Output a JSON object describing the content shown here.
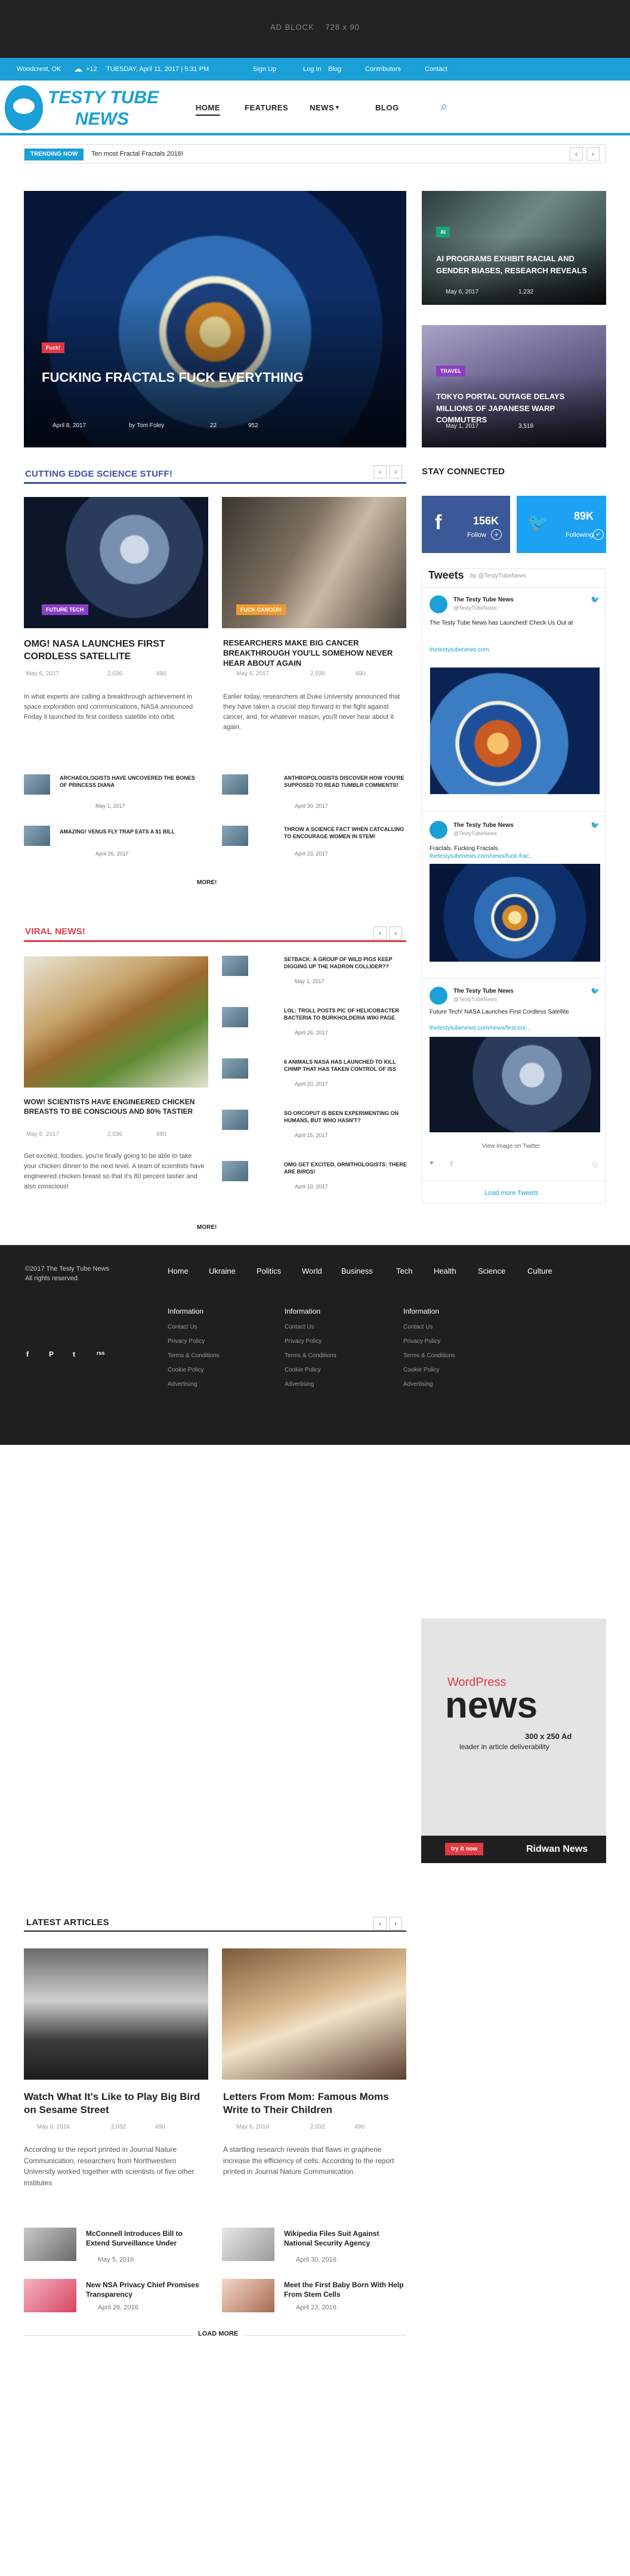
{
  "ad_top": {
    "label": "AD BLOCK",
    "size": "728 x 90"
  },
  "topbar": {
    "location": "Woodcrest, OK",
    "weather_temp": "+12",
    "date": "TUESDAY, April 11, 2017 | 5:31 PM",
    "links": [
      "Sign Up",
      "Log In",
      "Blog",
      "Contributors",
      "Contact"
    ]
  },
  "logo": {
    "line1": "TESTY TUBE",
    "line2": "NEWS"
  },
  "nav": {
    "items": [
      "HOME",
      "FEATURES",
      "NEWS",
      "BLOG"
    ],
    "news_caret": "▾"
  },
  "ticker": {
    "tag": "TRENDING NOW",
    "text": "Ten most Fractal Fractals 2016!"
  },
  "hero": {
    "main": {
      "category": "Fuck!",
      "title": "FUCKING FRACTALS FUCK EVERYTHING",
      "date": "April 8, 2017",
      "author": "by Tom Foley",
      "comments": "22",
      "views": "952"
    },
    "side1": {
      "category": "AI",
      "title": "AI PROGRAMS EXHIBIT RACIAL AND GENDER BIASES, RESEARCH REVEALS",
      "date": "May 6, 2017",
      "views": "1,232"
    },
    "side2": {
      "category": "TRAVEL",
      "title": "TOKYO PORTAL OUTAGE DELAYS MILLIONS OF JAPANESE WARP COMMUTERS",
      "date": "May 1, 2017",
      "views": "3,518"
    }
  },
  "science": {
    "heading": "CUTTING EDGE SCIENCE STUFF!",
    "color": "#3b4fa8",
    "post1": {
      "category": "FUTURE TECH",
      "title": "OMG! NASA LAUNCHES FIRST CORDLESS SATELLITE",
      "date": "May 6, 2017",
      "views": "2,036",
      "comments": "690",
      "excerpt": "In what experts are calling a breakthrough achievement in space exploration and communications, NASA announced Friday it launched its first cordless satellite into orbit."
    },
    "post2": {
      "category": "FUCK CANCER!",
      "title": "RESEARCHERS MAKE BIG CANCER BREAKTHROUGH YOU'LL SOMEHOW NEVER HEAR ABOUT AGAIN",
      "date": "May 6, 2017",
      "views": "2,036",
      "comments": "690",
      "excerpt": "Earlier today, researchers at Duke University announced that they have taken a crucial step forward in the fight against cancer, and, for whatever reason, you'll never hear about it again."
    },
    "list": [
      {
        "title": "ARCHAEOLOGISTS HAVE UNCOVERED THE BONES OF PRINCESS DIANA",
        "date": "May 1, 2017"
      },
      {
        "title": "ANTHROPOLOGISTS DISCOVER HOW YOU'RE SUPPOSED TO READ TUMBLR COMMENTS!",
        "date": "April 30, 2017"
      },
      {
        "title": "AMAZING! VENUS FLY TRAP EATS A $1 BILL",
        "date": "April 26, 2017"
      },
      {
        "title": "THROW A SCIENCE FACT WHEN CATCALLING TO ENCOURAGE WOMEN IN STEM!",
        "date": "April 23, 2017"
      }
    ],
    "more": "MORE!"
  },
  "viral": {
    "heading": "VIRAL NEWS!",
    "color": "#e03a45",
    "main": {
      "title": "WOW! SCIENTISTS HAVE ENGINEERED CHICKEN BREASTS TO BE CONSCIOUS AND 80% TASTIER",
      "date": "May 6, 2017",
      "views": "2,036",
      "comments": "690",
      "excerpt": "Get excited, foodies, you're finally going to be able to take your chicken dinner to the next level. A team of scientists have engineered chicken breast so that it's 80 percent tastier and also conscious!"
    },
    "list": [
      {
        "title": "SETBACK: A GROUP OF WILD PIGS KEEP DIGGING UP THE HADRON COLLIDER??",
        "date": "May 1, 2017"
      },
      {
        "title": "LOL: TROLL POSTS PIC OF HELICOBACTER BACTERIA TO BURKHOLDERIA WIKI PAGE",
        "date": "April 26, 2017"
      },
      {
        "title": "6 ANIMALS NASA HAS LAUNCHED TO KILL CHIMP THAT HAS TAKEN CONTROL OF ISS",
        "date": "April 20, 2017"
      },
      {
        "title": "SO ORCOPUT IS BEEN EXPERIMENTING ON HUMANS, BUT WHO HASN'T?",
        "date": "April 15, 2017"
      },
      {
        "title": "OMG GET EXCITED, ORNITHOLOGISTS: THERE ARE BIRDS!",
        "date": "April 10, 2017"
      }
    ],
    "more": "MORE!"
  },
  "sidebar": {
    "heading": "STAY CONNECTED",
    "facebook": {
      "count": "156K",
      "label": "Follow",
      "color": "#3b5998"
    },
    "twitter": {
      "count": "89K",
      "label": "Following",
      "color": "#1da1f2"
    },
    "tweets": {
      "title": "Tweets",
      "by": "by @TestyTubeNews",
      "items": [
        {
          "name": "The Testy Tube News",
          "handle": "@TestyTubeNews",
          "text": "The Testy Tube News has Launched! Check Us Out at",
          "link": "thetestytubenews.com"
        },
        {
          "name": "The Testy Tube News",
          "handle": "@TestyTubeNews",
          "text": "Fractals. Fucking Fractals.",
          "link": "thetestytubenews.com/news/fuck-frac..."
        },
        {
          "name": "The Testy Tube News",
          "handle": "@TestyTubeNews",
          "text": "Future Tech! NASA Launches First Cordless Satellite",
          "link": "thetestytubenews.com/news/first-cor..."
        }
      ],
      "view_image": "View image on Twitter",
      "load_more": "Load more Tweets"
    }
  },
  "footer": {
    "copyright1": "©2017 The Testy Tube News",
    "copyright2": "All rights reserved.",
    "nav": [
      "Home",
      "Ukraine",
      "Politics",
      "World",
      "Business",
      "Tech",
      "Health",
      "Science",
      "Culture"
    ],
    "columns": [
      {
        "heading": "Information",
        "links": [
          "Contact Us",
          "Privacy Policy",
          "Terms & Conditions",
          "Cookie Policy",
          "Advertising"
        ]
      },
      {
        "heading": "Information",
        "links": [
          "Contact Us",
          "Privacy Policy",
          "Terms & Conditions",
          "Cookie Policy",
          "Advertising"
        ]
      },
      {
        "heading": "Information",
        "links": [
          "Contact Us",
          "Privacy Policy",
          "Terms & Conditions",
          "Cookie Policy",
          "Advertising"
        ]
      }
    ],
    "social_icons": [
      "f",
      "P",
      "t",
      "rss"
    ]
  },
  "ad_side": {
    "brand1": "WordPress",
    "brand2": "news",
    "size": "300 x 250 Ad",
    "tagline": "leader in article deliverability",
    "button": "try it now",
    "brand_footer": "Ridwan News"
  },
  "latest": {
    "heading": "LATEST ARTICLES",
    "post1": {
      "title": "Watch What It's Like to Play Big Bird on Sesame Street",
      "date": "May 6, 2016",
      "views": "2,032",
      "comments": "490",
      "excerpt": "According to the report printed in Journal Nature Communication, researchers from Northwestern University worked together with scientists of five other institutes"
    },
    "post2": {
      "title": "Letters From Mom: Famous Moms Write to Their Children",
      "date": "May 6, 2016",
      "views": "2,032",
      "comments": "490",
      "excerpt": "A startling research reveals that flaws in graphene increase the efficiency of cells. According to the report printed in Journal Nature Communication."
    },
    "list": [
      {
        "title": "McConnell Introduces Bill to Extend Surveillance Under",
        "date": "May 5, 2016"
      },
      {
        "title": "Wikipedia Files Suit Against National Security Agency",
        "date": "April 30, 2016"
      },
      {
        "title": "New NSA Privacy Chief Promises Transparency",
        "date": "April 26, 2016"
      },
      {
        "title": "Meet the First Baby Born With Help From Stem Cells",
        "date": "April 23, 2016"
      }
    ],
    "load_more": "LOAD MORE"
  }
}
